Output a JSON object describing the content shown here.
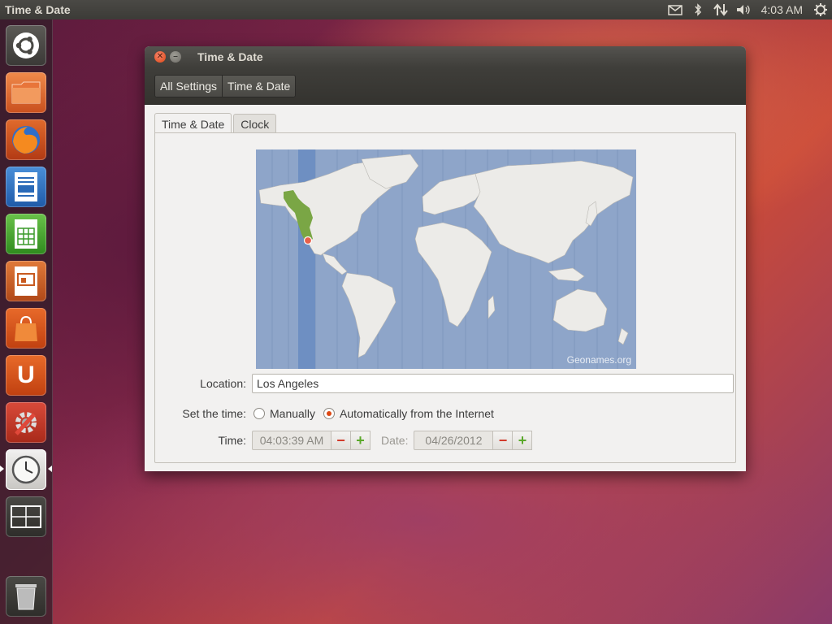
{
  "top_panel": {
    "app_title": "Time & Date",
    "clock": "4:03 AM",
    "indicators": [
      "mail-icon",
      "bluetooth-icon",
      "network-icon",
      "volume-icon",
      "power-gear-icon"
    ]
  },
  "launcher": {
    "items": [
      "dash-home",
      "files",
      "firefox",
      "libreoffice-writer",
      "libreoffice-calc",
      "libreoffice-impress",
      "ubuntu-software-center",
      "ubuntu-one",
      "system-settings",
      "time-and-date",
      "workspace-switcher",
      "trash"
    ]
  },
  "window": {
    "title": "Time & Date",
    "breadcrumbs": [
      "All Settings",
      "Time & Date"
    ],
    "tabs": [
      "Time & Date",
      "Clock"
    ],
    "map_credit": "Geonames.org",
    "location_label": "Location:",
    "location_value": "Los Angeles",
    "set_time_label": "Set the time:",
    "option_manual": "Manually",
    "option_auto": "Automatically from the Internet",
    "auto_selected": true,
    "time_label": "Time:",
    "time_value": "04:03:39 AM",
    "date_label": "Date:",
    "date_value": "04/26/2012"
  },
  "colors": {
    "accent": "#dd4814",
    "map_ocean": "#8ea5c9",
    "timezone_highlight": "#7aa645"
  }
}
